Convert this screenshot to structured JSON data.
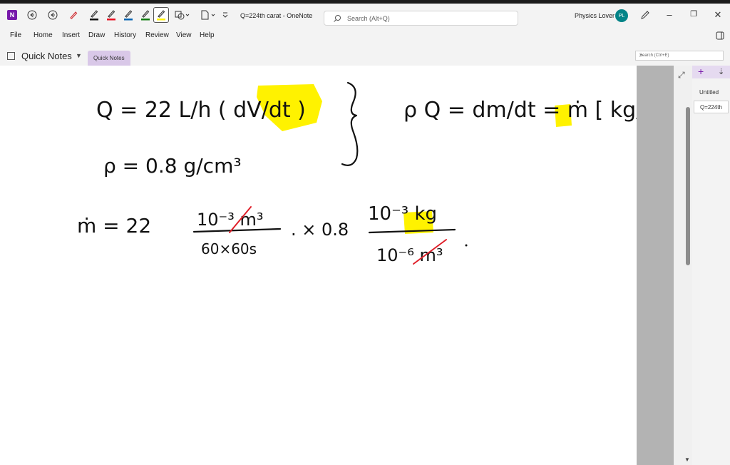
{
  "app": {
    "logo": "N",
    "window_title": "Q=224th carat  -  OneNote",
    "search_placeholder": "Search (Alt+Q)",
    "user_name": "Physics Lover",
    "user_initials": "PL"
  },
  "toolbar_icons": [
    "back-icon",
    "forward-icon",
    "pen-red-icon",
    "pen-black-icon",
    "pen-red2-icon",
    "pen-blue-icon",
    "pen-green-icon",
    "highlighter-icon",
    "shapes-icon",
    "page-format-icon",
    "more-icon"
  ],
  "menu": [
    "File",
    "Home",
    "Insert",
    "Draw",
    "History",
    "Review",
    "View",
    "Help"
  ],
  "notebook": {
    "name": "Quick Notes",
    "section": "Quick Notes",
    "search_placeholder": "Search (Ctrl+E)"
  },
  "pages": [
    {
      "title": "Untitled"
    },
    {
      "title": "Q=224th"
    }
  ],
  "ink": {
    "line1_left": "Q  =  22  L/h  ( dV/dt )",
    "line1_right": "ρ Q  =  dm/dt = ṁ  [ kg/s ]",
    "line2": "ρ  =  0.8  g/cm³",
    "line3_lhs": "ṁ  =  22",
    "frac1_num": "10⁻³ m³",
    "frac1_den": "60×60s",
    "mult": ". × 0.8",
    "frac2_num": "10⁻³ kg",
    "frac2_den": "10⁻⁶ m³"
  },
  "colors": {
    "accent": "#7719aa",
    "highlight": "#fff200",
    "strike": "#e0202a",
    "avatar": "#038387"
  }
}
